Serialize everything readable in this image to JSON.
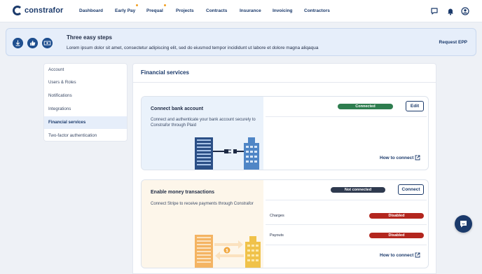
{
  "brand": {
    "name": "constrafor"
  },
  "nav": {
    "items": [
      {
        "label": "Dashboard",
        "badge": false
      },
      {
        "label": "Early Pay",
        "badge": true
      },
      {
        "label": "Prequal",
        "badge": true
      },
      {
        "label": "Projects",
        "badge": false
      },
      {
        "label": "Contracts",
        "badge": false
      },
      {
        "label": "Insurance",
        "badge": false
      },
      {
        "label": "Invoicing",
        "badge": false
      },
      {
        "label": "Contractors",
        "badge": false
      }
    ],
    "icons": [
      "chat-icon",
      "bell-icon",
      "user-account-icon"
    ]
  },
  "banner": {
    "title": "Three easy steps",
    "text": "Lorem ipsum dolor sit amet, consectetur adipiscing elit, sed do eiusmod tempor incididunt ut labore et dolore magna aliqaqua",
    "link": "Request EPP",
    "icons": [
      "download-icon",
      "thumbs-up-icon",
      "money-icon"
    ]
  },
  "sidebar": {
    "items": [
      {
        "label": "Account",
        "active": false
      },
      {
        "label": "Users & Roles",
        "active": false
      },
      {
        "label": "Notifications",
        "active": false
      },
      {
        "label": "Integrations",
        "active": false
      },
      {
        "label": "Financial services",
        "active": true
      },
      {
        "label": "Two-factor authentication",
        "active": false
      }
    ]
  },
  "main": {
    "title": "Financial services",
    "cards": [
      {
        "title": "Connect bank account",
        "description": "Connect and authenticate your bank account securely to Constrafor through Plaid",
        "status": "Connected",
        "status_color": "#2e7d4f",
        "button": "Edit",
        "howto": "How to connect",
        "illustration": "bank-connect-illustration"
      },
      {
        "title": "Enable money transactions",
        "description": "Connect Stripe to receive payments through Constrafor",
        "status": "Not connected",
        "status_color": "#2f3a4f",
        "button": "Connect",
        "rows": [
          {
            "label": "Charges",
            "status": "Disabled",
            "color": "#b3261e"
          },
          {
            "label": "Payouts",
            "status": "Disabled",
            "color": "#b3261e"
          }
        ],
        "howto": "How to connect",
        "illustration": "money-transfer-illustration"
      }
    ]
  },
  "colors": {
    "brand": "#1b3a6b",
    "accent_dot": "#f2a024",
    "bank_panel": "#eaf2fb",
    "money_panel": "#fdf6ea"
  }
}
